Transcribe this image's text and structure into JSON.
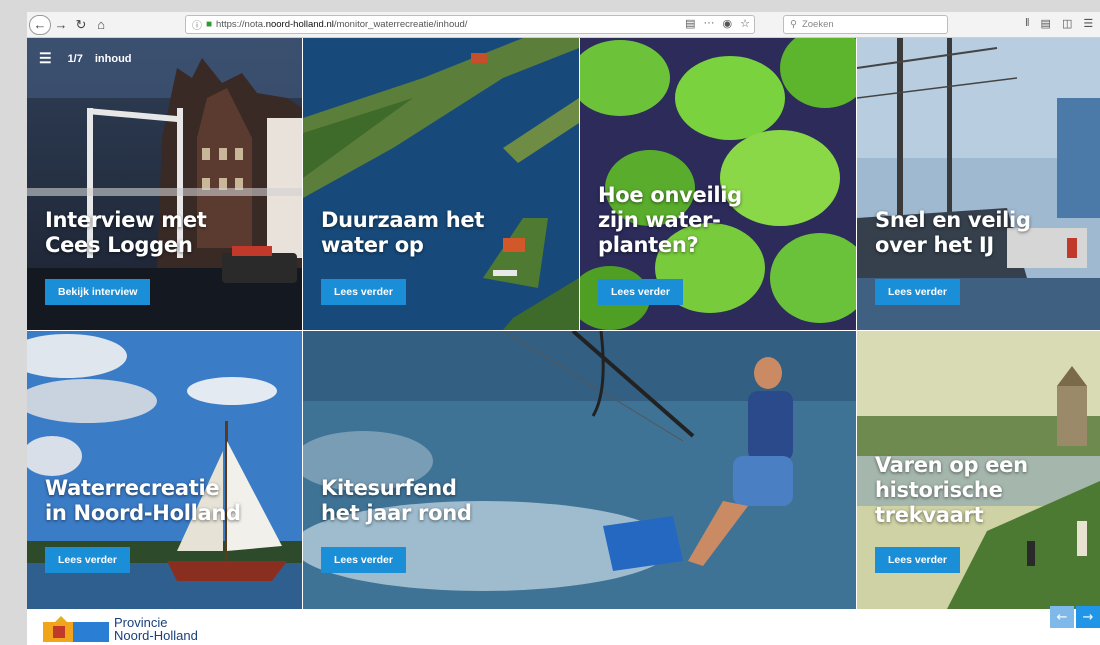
{
  "browser": {
    "url_prefix": "https://nota.",
    "url_domain": "noord-holland.nl",
    "url_path": "/monitor_waterrecreatie/inhoud/",
    "search_placeholder": "Zoeken",
    "icons": [
      "back-icon",
      "forward-icon",
      "reload-icon",
      "home-icon",
      "info-icon",
      "lock-icon",
      "reader-icon",
      "more-icon",
      "pocket-icon",
      "star-icon",
      "search-icon",
      "library-icon",
      "synced-tabs-icon",
      "sidebar-icon",
      "menu-icon"
    ]
  },
  "nav": {
    "page_counter": "1/7",
    "section_label": "inhoud"
  },
  "tiles": [
    {
      "title_line1": "Interview met",
      "title_line2": "Cees Loggen",
      "title_line3": "",
      "button": "Bekijk interview"
    },
    {
      "title_line1": "Duurzaam het",
      "title_line2": "water op",
      "title_line3": "",
      "button": "Lees verder"
    },
    {
      "title_line1": "Hoe onveilig",
      "title_line2": "zijn water-",
      "title_line3": "planten?",
      "button": "Lees verder"
    },
    {
      "title_line1": "Snel en veilig",
      "title_line2": "over het IJ",
      "title_line3": "",
      "button": "Lees verder"
    },
    {
      "title_line1": "Waterrecreatie",
      "title_line2": "in Noord-Holland",
      "title_line3": "",
      "button": "Lees verder"
    },
    {
      "title_line1": "Kitesurfend",
      "title_line2": "het jaar rond",
      "title_line3": "",
      "button": "Lees verder"
    },
    {
      "title_line1": "Varen op een",
      "title_line2": "historische",
      "title_line3": "trekvaart",
      "button": "Lees verder"
    }
  ],
  "footer": {
    "logo_line1": "Provincie",
    "logo_line2": "Noord-Holland"
  },
  "colors": {
    "accent": "#1a8fd8",
    "logo_blue": "#1a3f7a"
  }
}
